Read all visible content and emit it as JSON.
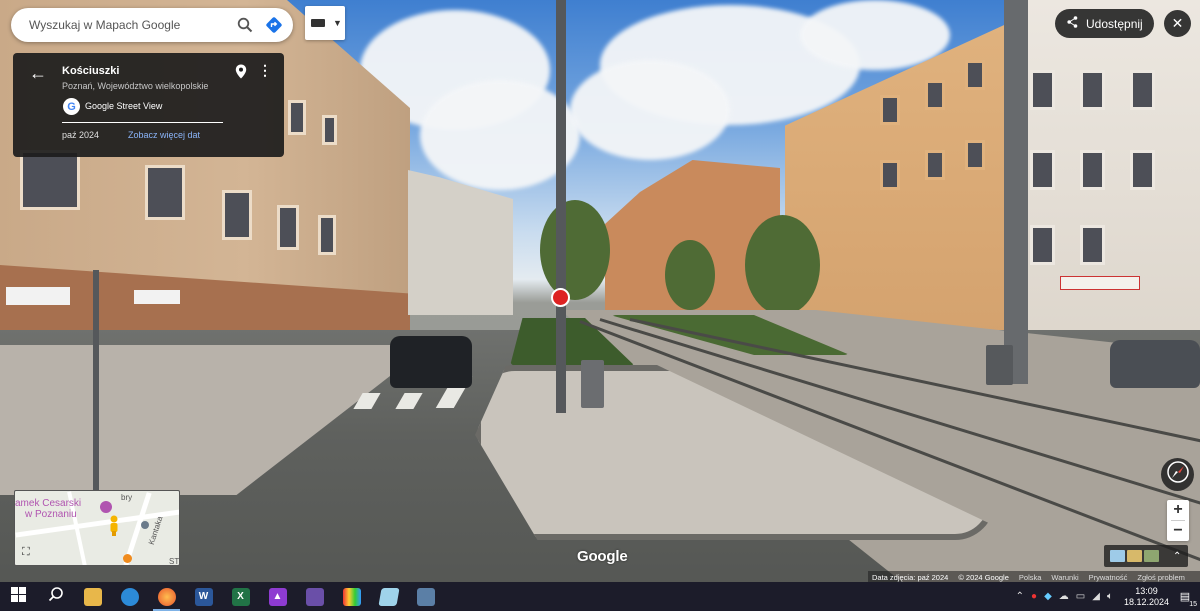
{
  "search": {
    "placeholder": "Wyszukaj w Mapach Google"
  },
  "location_card": {
    "title": "Kościuszki",
    "subtitle": "Poznań, Województwo wielkopolskie",
    "source": "Google Street View",
    "date": "paź 2024",
    "more_dates_link": "Zobacz więcej dat"
  },
  "share": {
    "label": "Udostępnij"
  },
  "minimap": {
    "poi_line1": "amek Cesarski",
    "poi_line2": "w Poznaniu",
    "street_a": "Kantaka",
    "street_b": "bry",
    "street_c": "ST"
  },
  "watermark": "Google",
  "attribution": {
    "date": "Data zdjęcia: paź 2024",
    "copyright": "© 2024 Google",
    "country": "Polska",
    "terms": "Warunki",
    "privacy": "Prywatność",
    "report": "Zgłoś problem"
  },
  "taskbar": {
    "apps": [
      "start-icon",
      "search-icon",
      "file-explorer-icon",
      "edge-icon",
      "firefox-icon",
      "word-icon",
      "excel-icon",
      "affinity-icon",
      "photo-icon",
      "color-app-icon",
      "cube-app-icon",
      "calculator-icon"
    ],
    "time": "13:09",
    "date": "18.12.2024",
    "notification_count": "15"
  },
  "colors": {
    "card_bg": "#1c1c1c",
    "link": "#8ab4f8",
    "taskbar_bg": "#1c1c2a",
    "accent": "#4285f4"
  }
}
